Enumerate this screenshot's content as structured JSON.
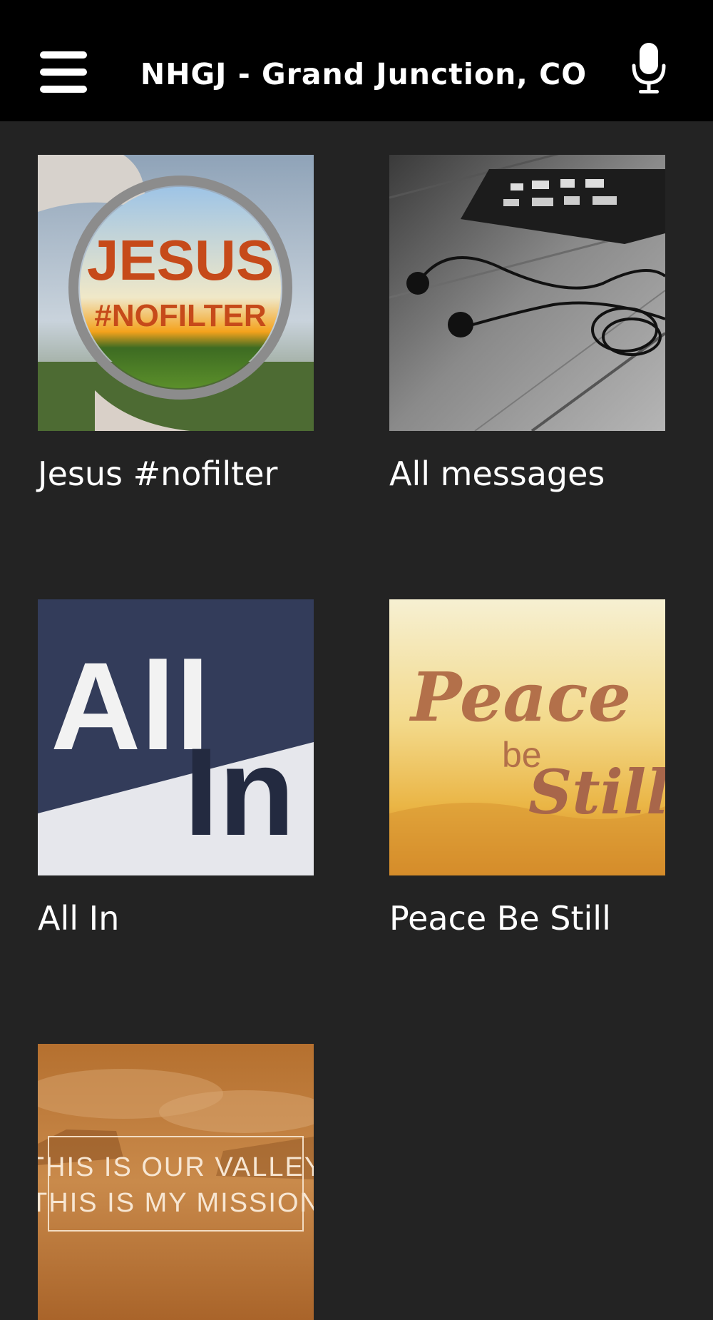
{
  "header": {
    "title": "NHGJ - Grand Junction, CO",
    "menu_icon": "hamburger-menu-icon",
    "mic_icon": "microphone-icon"
  },
  "series": [
    {
      "label": "Jesus #nofilter",
      "art_text_1": "JESUS",
      "art_text_2": "#NOFILTER"
    },
    {
      "label": "All messages"
    },
    {
      "label": "All In",
      "art_text_1": "All",
      "art_text_2": "In"
    },
    {
      "label": "Peace Be Still",
      "art_text_1": "Peace",
      "art_text_2": "be",
      "art_text_3": "Still"
    },
    {
      "label": "",
      "art_text_1": "THIS IS OUR VALLEY",
      "art_text_2": "THIS IS MY MISSION"
    }
  ],
  "colors": {
    "header_bg": "#000000",
    "page_bg": "#232323",
    "text": "#ffffff"
  }
}
